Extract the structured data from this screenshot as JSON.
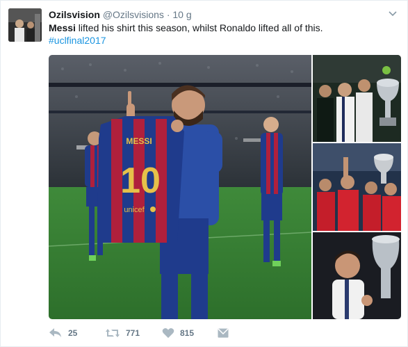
{
  "tweet": {
    "display_name": "Ozilsvision",
    "handle": "@Ozilsvisions",
    "separator": "·",
    "time": "10 g",
    "text_bold": "Messi",
    "text_rest": " lifted his shirt this season, whilst Ronaldo lifted all of this.",
    "hashtag": "#uclfinal2017",
    "jersey_name": "MESSI",
    "jersey_number": "10",
    "jersey_sponsor": "unicef"
  },
  "actions": {
    "reply_count": "25",
    "retweet_count": "771",
    "like_count": "815"
  },
  "icons": {
    "caret": "chevron-down-icon",
    "reply": "reply-icon",
    "retweet": "retweet-icon",
    "like": "heart-icon",
    "dm": "envelope-icon"
  },
  "colors": {
    "link": "#1b95e0",
    "text": "#14171a",
    "muted": "#657786",
    "barca_blue": "#1f3b8c",
    "barca_red": "#b0203c",
    "real_white": "#ffffff"
  }
}
